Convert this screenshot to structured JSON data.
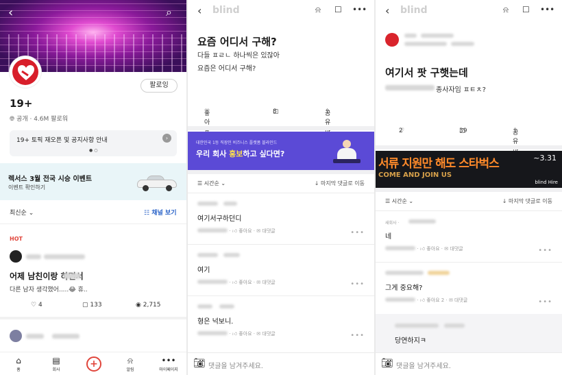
{
  "panel1": {
    "channel_name": "19+",
    "meta": "공개 · 4.6M 팔로워",
    "follow_label": "팔로잉",
    "notice": "19+ 토픽 재오픈 및 공지사항 안내",
    "ad": {
      "title": "렉서스 3월 전국 시승 이벤트",
      "subtitle": "이벤트 확인하기"
    },
    "sort_label": "최신순",
    "channel_view": "채널 보기",
    "hot_label": "HOT",
    "post": {
      "title": "어제 남친이랑 하면서",
      "preview": "다른 남자 생각했어.....😂 휴..",
      "likes": "4",
      "comments": "133",
      "views": "2,715"
    },
    "tabs": [
      {
        "label": "홈",
        "icon": "home-icon"
      },
      {
        "label": "회사",
        "icon": "company-icon"
      },
      {
        "label": "",
        "icon": "plus-icon"
      },
      {
        "label": "알림",
        "icon": "bell-icon"
      },
      {
        "label": "마이페이지",
        "icon": "more-icon"
      }
    ]
  },
  "panel2": {
    "brand": "blind",
    "title": "요즘 어디서 구해?",
    "body_lines": [
      "다들 ㅍㄹㄴ 하나씩은 있잖아",
      "요즘은 어디서 구해?"
    ],
    "like_label": "좋아요",
    "comment_count": "8",
    "share_label": "공유하기",
    "ad": {
      "small": "대한민국 1등 직장인 비즈니스 플랫폼 블라인드",
      "big_pre": "우리 회사 ",
      "big_em": "홍보",
      "big_post": "하고 싶다면?"
    },
    "sort_label": "시간순",
    "jump_label": "마지막 댓글로 이동",
    "comments": [
      {
        "text": "여기서구하던디",
        "like": "좋아요",
        "reply": "대댓글"
      },
      {
        "text": "여기",
        "like": "좋아요",
        "reply": "대댓글"
      },
      {
        "text": "형은 넉보니.",
        "like": "좋아요",
        "reply": "대댓글"
      }
    ],
    "input_placeholder": "댓글을 남겨주세요."
  },
  "panel3": {
    "brand": "blind",
    "title": "여기서 팟 구햇는데",
    "body_suffix": "종사자임 ㅍㅌㅊ?",
    "like_count": "2",
    "comment_count": "39",
    "share_label": "공유하기",
    "ad": {
      "title": "서류 지원만 해도 스타벅스",
      "sub": "COME AND JOIN US",
      "date": "~3.31",
      "brand": "blind Hire"
    },
    "sort_label": "시간순",
    "jump_label": "마지막 댓글로 이동",
    "comments": [
      {
        "meta": "새회사 ·",
        "text": "네",
        "like": "좋아요",
        "reply": "대댓글"
      },
      {
        "meta": "",
        "text": "그게 중요해?",
        "like": "좋아요 2",
        "reply": "대댓글"
      },
      {
        "meta": "",
        "text": "당연하지ㅋ",
        "like": "",
        "reply": ""
      }
    ],
    "input_placeholder": "댓글을 남겨주세요."
  }
}
